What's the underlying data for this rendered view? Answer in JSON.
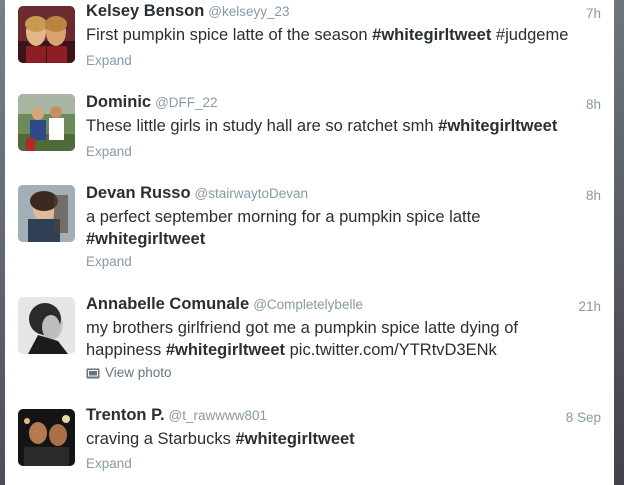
{
  "tweets": [
    {
      "name": "Kelsey Benson",
      "handle": "@kelseyy_23",
      "time": "7h",
      "text_parts": [
        "First pumpkin spice latte of the season ",
        "#whitegirltweet",
        " #judgeme"
      ],
      "action": "Expand"
    },
    {
      "name": "Dominic",
      "handle": "@DFF_22",
      "time": "8h",
      "text_parts": [
        "These little girls in study hall are so ratchet smh ",
        "#whitegirltweet"
      ],
      "action": "Expand"
    },
    {
      "name": "Devan Russo",
      "handle": "@stairwaytoDevan",
      "time": "8h",
      "text_parts": [
        "a perfect september morning for a pumpkin spice latte ",
        "#whitegirltweet"
      ],
      "action": "Expand"
    },
    {
      "name": "Annabelle Comunale",
      "handle": "@Completelybelle",
      "time": "21h",
      "text_parts": [
        "my brothers girlfriend got me a pumpkin spice latte dying of happiness ",
        "#whitegirltweet",
        " pic.twitter.com/YTRtvD3ENk"
      ],
      "action": "View photo",
      "action_icon": "photo-icon"
    },
    {
      "name": "Trenton P.",
      "handle": "@t_rawwww801",
      "time": "8 Sep",
      "text_parts": [
        "craving a Starbucks ",
        "#whitegirltweet"
      ],
      "action": "Expand"
    }
  ]
}
